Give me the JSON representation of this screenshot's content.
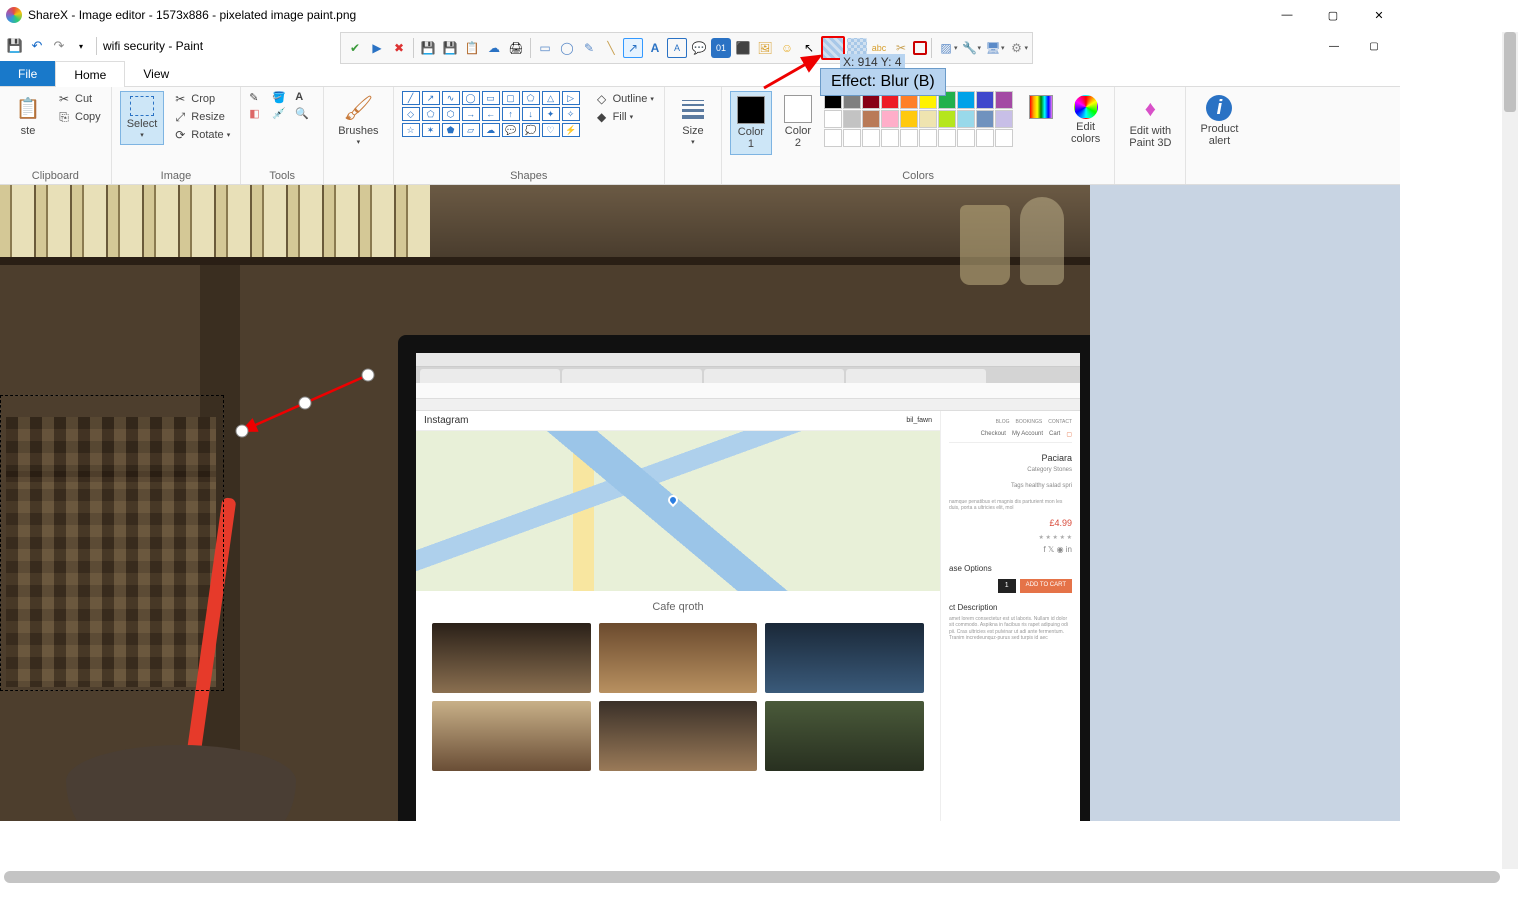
{
  "sharex": {
    "title": "ShareX - Image editor - 1573x886 - pixelated image paint.png",
    "coords": "X: 914 Y: 4",
    "tooltip": "Effect: Blur (B)",
    "toolbar_icons": [
      "check",
      "play",
      "cancel",
      "save",
      "save-as",
      "clipboard-copy",
      "clipboard-paste",
      "print",
      "upload",
      "rectangle-select",
      "rounded-rect",
      "ellipse",
      "line",
      "arrow",
      "text",
      "text-box",
      "speech",
      "step",
      "magnify",
      "sticker",
      "image",
      "smile",
      "cursor",
      "blur",
      "pixelate",
      "highlight",
      "crop",
      "cut-out",
      "color-picker",
      "options",
      "tools",
      "wrench",
      "gear"
    ]
  },
  "paint": {
    "title": "wifi security - Paint",
    "tabs": {
      "file": "File",
      "home": "Home",
      "view": "View"
    },
    "groups": {
      "clipboard": {
        "label": "Clipboard",
        "paste": "ste",
        "cut": "Cut",
        "copy": "Copy"
      },
      "image": {
        "label": "Image",
        "select": "Select",
        "crop": "Crop",
        "resize": "Resize",
        "rotate": "Rotate"
      },
      "tools": {
        "label": "Tools"
      },
      "brushes": {
        "label": "Brushes",
        "btn": "Brushes"
      },
      "shapes": {
        "label": "Shapes",
        "outline": "Outline",
        "fill": "Fill"
      },
      "size": {
        "label": "Size",
        "btn": "Size"
      },
      "colors": {
        "label": "Colors",
        "c1": "Color\n1",
        "c2": "Color\n2",
        "edit": "Edit\ncolors",
        "palette_row1": [
          "#000000",
          "#7f7f7f",
          "#880015",
          "#ed1c24",
          "#ff7f27",
          "#fff200",
          "#22b14c",
          "#00a2e8",
          "#3f48cc",
          "#a349a4"
        ],
        "palette_row2": [
          "#ffffff",
          "#c3c3c3",
          "#b97a57",
          "#ffaec9",
          "#ffc90e",
          "#efe4b0",
          "#b5e61d",
          "#99d9ea",
          "#7092be",
          "#c8bfe7"
        ],
        "palette_row3": [
          "#ffffff",
          "#ffffff",
          "#ffffff",
          "#ffffff",
          "#ffffff",
          "#ffffff",
          "#ffffff",
          "#ffffff",
          "#ffffff",
          "#ffffff"
        ]
      },
      "paint3d": {
        "btn": "Edit with\nPaint 3D"
      },
      "alert": {
        "btn": "Product\nalert"
      }
    }
  },
  "laptop": {
    "insta_logo": "Instagram",
    "insta_user": "bil_fawn",
    "cafe_title": "Cafe qroth",
    "right": {
      "nav": [
        "BLOG",
        "BOOKINGS",
        "CONTACT"
      ],
      "sub": [
        "Checkout",
        "My Account",
        "Cart"
      ],
      "product": "Paciara",
      "meta1": "Category Stones",
      "meta2": "Tags healthy salad spri",
      "lorem1": "namque penatibus et magnis dis parturient mon les duis, porta a ultricies elit, mol",
      "price": "£4.99",
      "opts": "ase Options",
      "qty": "1",
      "cart": "ADD TO CART",
      "desc": "ct Description",
      "lorem2": "amet lorem consectetur est ut laboris. Nullam id dolor sit commodo. Aspikna in facibus ris rapet adipuing odi pii. Cras ultricies est pulvinar ut adi ante fermentum. Tranim incredeunquz-purus sed turpis id aec"
    }
  }
}
